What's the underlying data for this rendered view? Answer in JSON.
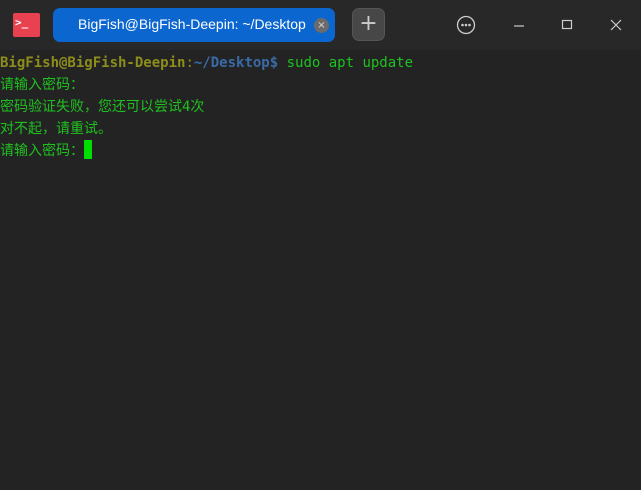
{
  "tab": {
    "title": "BigFish@BigFish-Deepin: ~/Desktop",
    "close": "×"
  },
  "new_tab": "+",
  "app_icon": ">_",
  "terminal": {
    "user": "BigFish@BigFish-Deepin",
    "colon": ":",
    "path": "~/Desktop",
    "prompt": "$ ",
    "command": "sudo apt update",
    "lines": [
      "请输入密码：",
      "密码验证失败，您还可以尝试4次",
      "对不起，请重试。",
      "请输入密码："
    ]
  }
}
